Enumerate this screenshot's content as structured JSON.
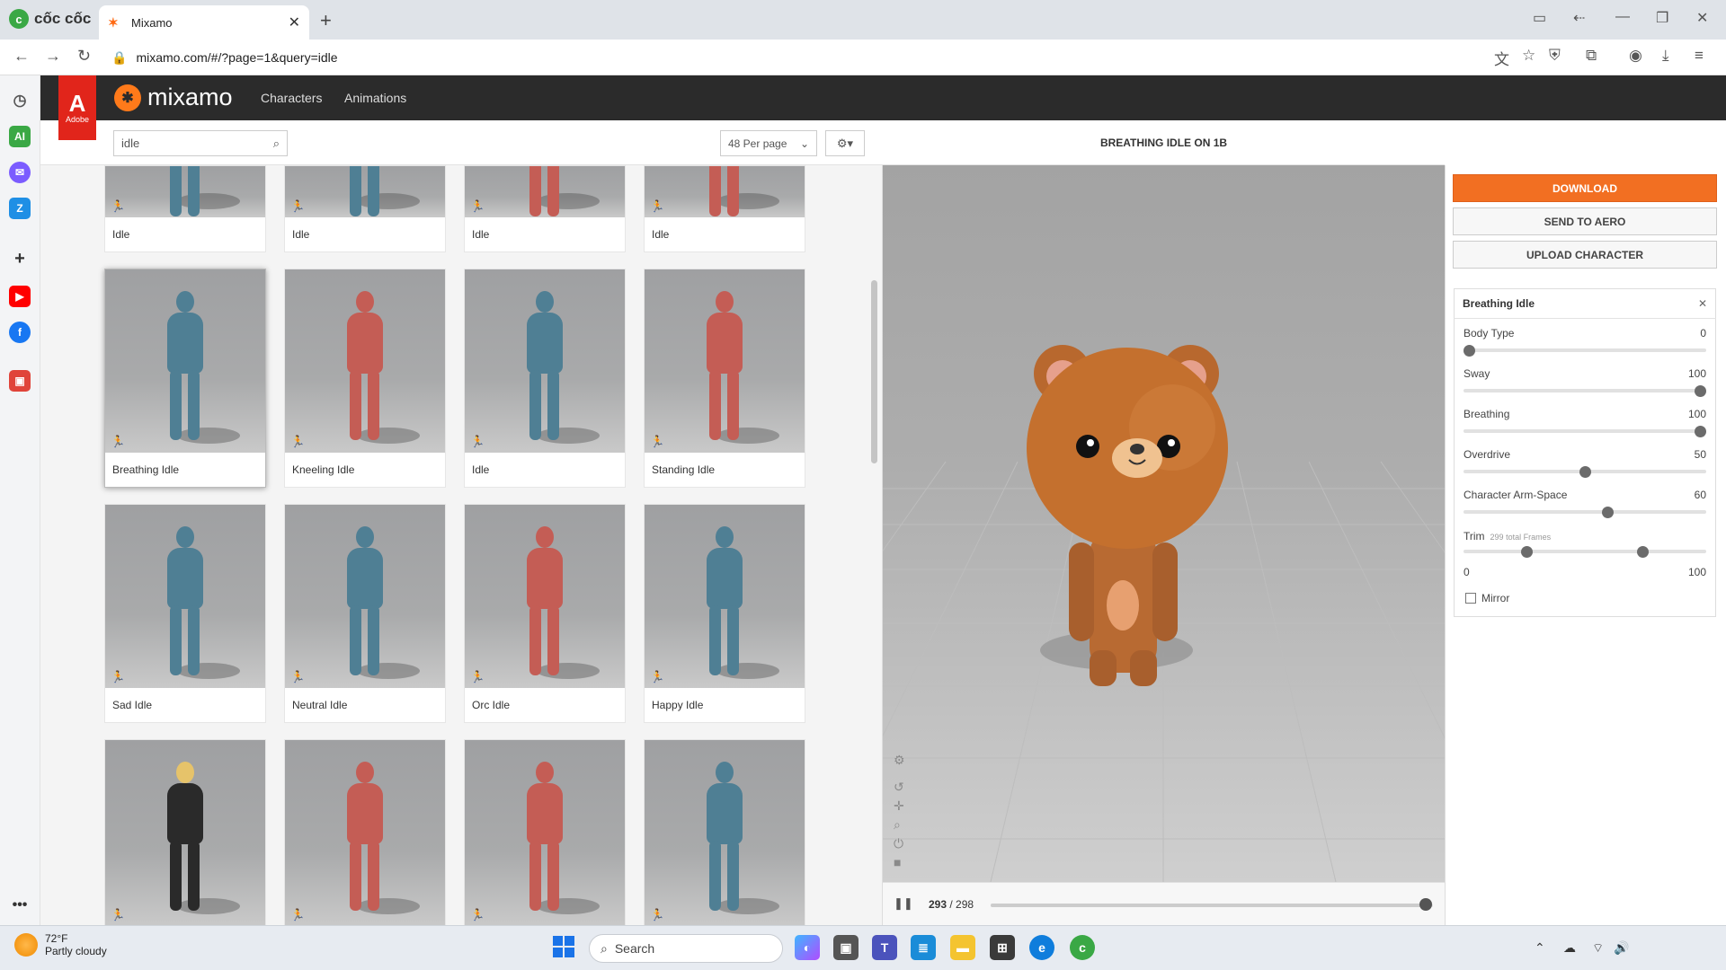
{
  "browser": {
    "brand": "cốc cốc",
    "tab_title": "Mixamo",
    "url": "mixamo.com/#/?page=1&query=idle"
  },
  "mixamo": {
    "adobe_label": "Adobe",
    "logo_text": "mixamo",
    "nav": [
      "Characters",
      "Animations"
    ],
    "search_value": "idle",
    "per_page": "48 Per page"
  },
  "cards": [
    {
      "label": "Idle",
      "color": "blue"
    },
    {
      "label": "Idle",
      "color": "blue"
    },
    {
      "label": "Idle",
      "color": "red"
    },
    {
      "label": "Idle",
      "color": "red"
    },
    {
      "label": "Breathing Idle",
      "color": "blue",
      "selected": true
    },
    {
      "label": "Kneeling Idle",
      "color": "red"
    },
    {
      "label": "Idle",
      "color": "blue"
    },
    {
      "label": "Standing Idle",
      "color": "red"
    },
    {
      "label": "Sad Idle",
      "color": "blue"
    },
    {
      "label": "Neutral Idle",
      "color": "blue"
    },
    {
      "label": "Orc Idle",
      "color": "red"
    },
    {
      "label": "Happy Idle",
      "color": "blue"
    },
    {
      "label": "",
      "color": "gold"
    },
    {
      "label": "",
      "color": "red"
    },
    {
      "label": "",
      "color": "red"
    },
    {
      "label": "",
      "color": "blue"
    }
  ],
  "viewer": {
    "title": "BREATHING IDLE ON 1B",
    "frame_current": "293",
    "frame_sep": " / ",
    "frame_total": "298",
    "progress": 0.983
  },
  "actions": {
    "download": "DOWNLOAD",
    "send": "SEND TO AERO",
    "upload": "UPLOAD CHARACTER"
  },
  "settings": {
    "title": "Breathing Idle",
    "sliders": [
      {
        "label": "Body Type",
        "value": "0",
        "fraction": 0.0
      },
      {
        "label": "Sway",
        "value": "100",
        "fraction": 1.0
      },
      {
        "label": "Breathing",
        "value": "100",
        "fraction": 1.0
      },
      {
        "label": "Overdrive",
        "value": "50",
        "fraction": 0.5
      },
      {
        "label": "Character Arm-Space",
        "value": "60",
        "fraction": 0.6
      }
    ],
    "trim_label": "Trim",
    "trim_note": "299 total Frames",
    "trim_min": "0",
    "trim_max": "100",
    "trim_start": 0.25,
    "trim_end": 0.75,
    "mirror": "Mirror"
  },
  "taskbar": {
    "temp": "72°F",
    "weather": "Partly cloudy",
    "search": "Search"
  },
  "colors": {
    "accent": "#f26f22",
    "adobe_red": "#e1251b",
    "header": "#2b2b2b"
  }
}
